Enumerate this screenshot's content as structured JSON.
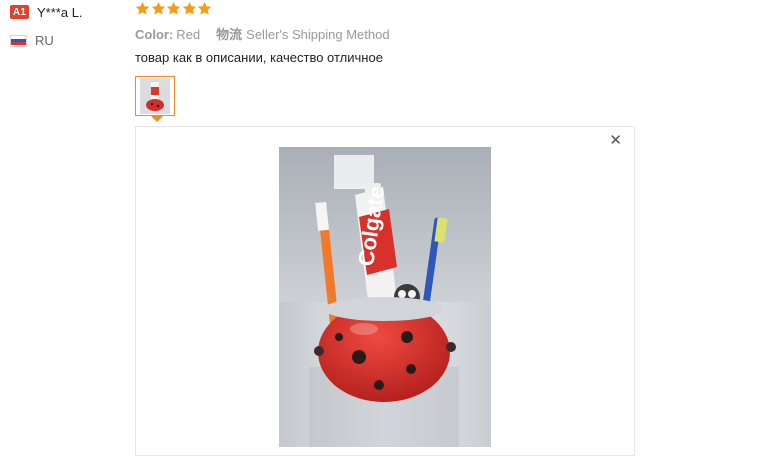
{
  "reviewer": {
    "level_badge": "A1",
    "name": "Y***a L.",
    "country_code": "RU",
    "flag_colors": [
      "#ffffff",
      "#2a57c5",
      "#e0322c"
    ]
  },
  "review": {
    "rating": 5,
    "rating_max": 5,
    "star_color": "#f59c16",
    "color_label": "Color:",
    "color_value": "Red",
    "shipping_label": "物流",
    "shipping_value": "Seller's Shipping Method",
    "text": "товар как в описании, качество отличное"
  },
  "gallery": {
    "accent_color": "#f08a24",
    "close_icon": "close-icon",
    "close_glyph": "✕",
    "photo_brand_text": "Colgate"
  }
}
